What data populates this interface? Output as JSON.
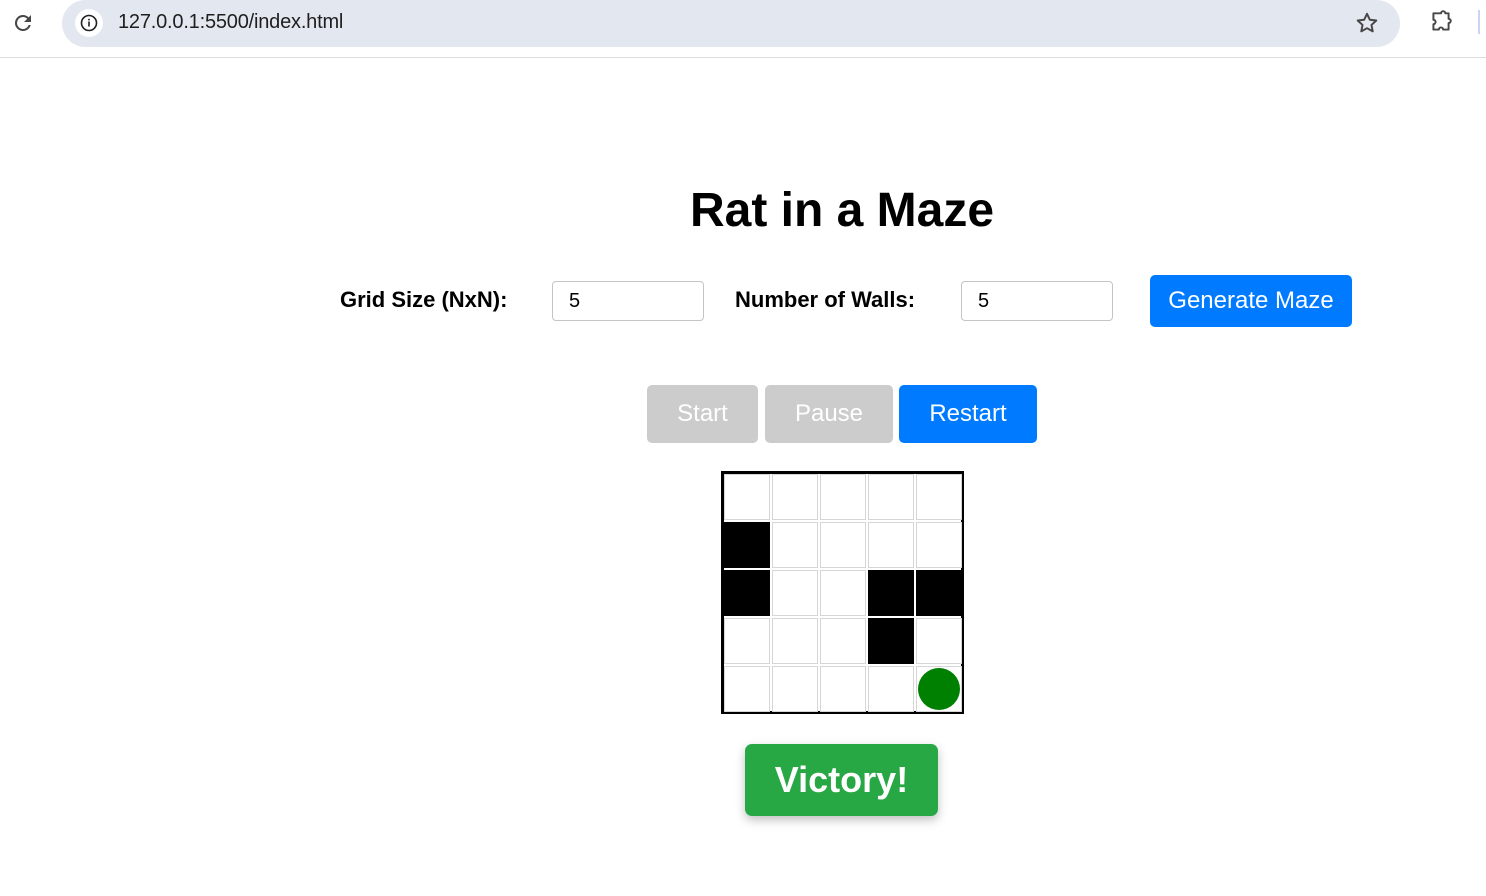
{
  "browser": {
    "url": "127.0.0.1:5500/index.html"
  },
  "page": {
    "title": "Rat in a Maze"
  },
  "controls": {
    "grid_size_label": "Grid Size (NxN):",
    "grid_size_value": "5",
    "walls_label": "Number of Walls:",
    "walls_value": "5",
    "generate_label": "Generate Maze",
    "start_label": "Start",
    "pause_label": "Pause",
    "restart_label": "Restart"
  },
  "maze": {
    "size": 5,
    "cells": [
      [
        0,
        0,
        0,
        0,
        0
      ],
      [
        1,
        0,
        0,
        0,
        0
      ],
      [
        1,
        0,
        0,
        1,
        1
      ],
      [
        0,
        0,
        0,
        1,
        0
      ],
      [
        0,
        0,
        0,
        0,
        0
      ]
    ],
    "rat_position": {
      "row": 4,
      "col": 4
    },
    "rat_color": "#008000"
  },
  "status": {
    "message": "Victory!"
  },
  "colors": {
    "primary": "#007bff",
    "disabled": "#cccccc",
    "success": "#28a745"
  },
  "icons": [
    "reload-icon",
    "info-icon",
    "star-icon",
    "extensions-icon"
  ]
}
